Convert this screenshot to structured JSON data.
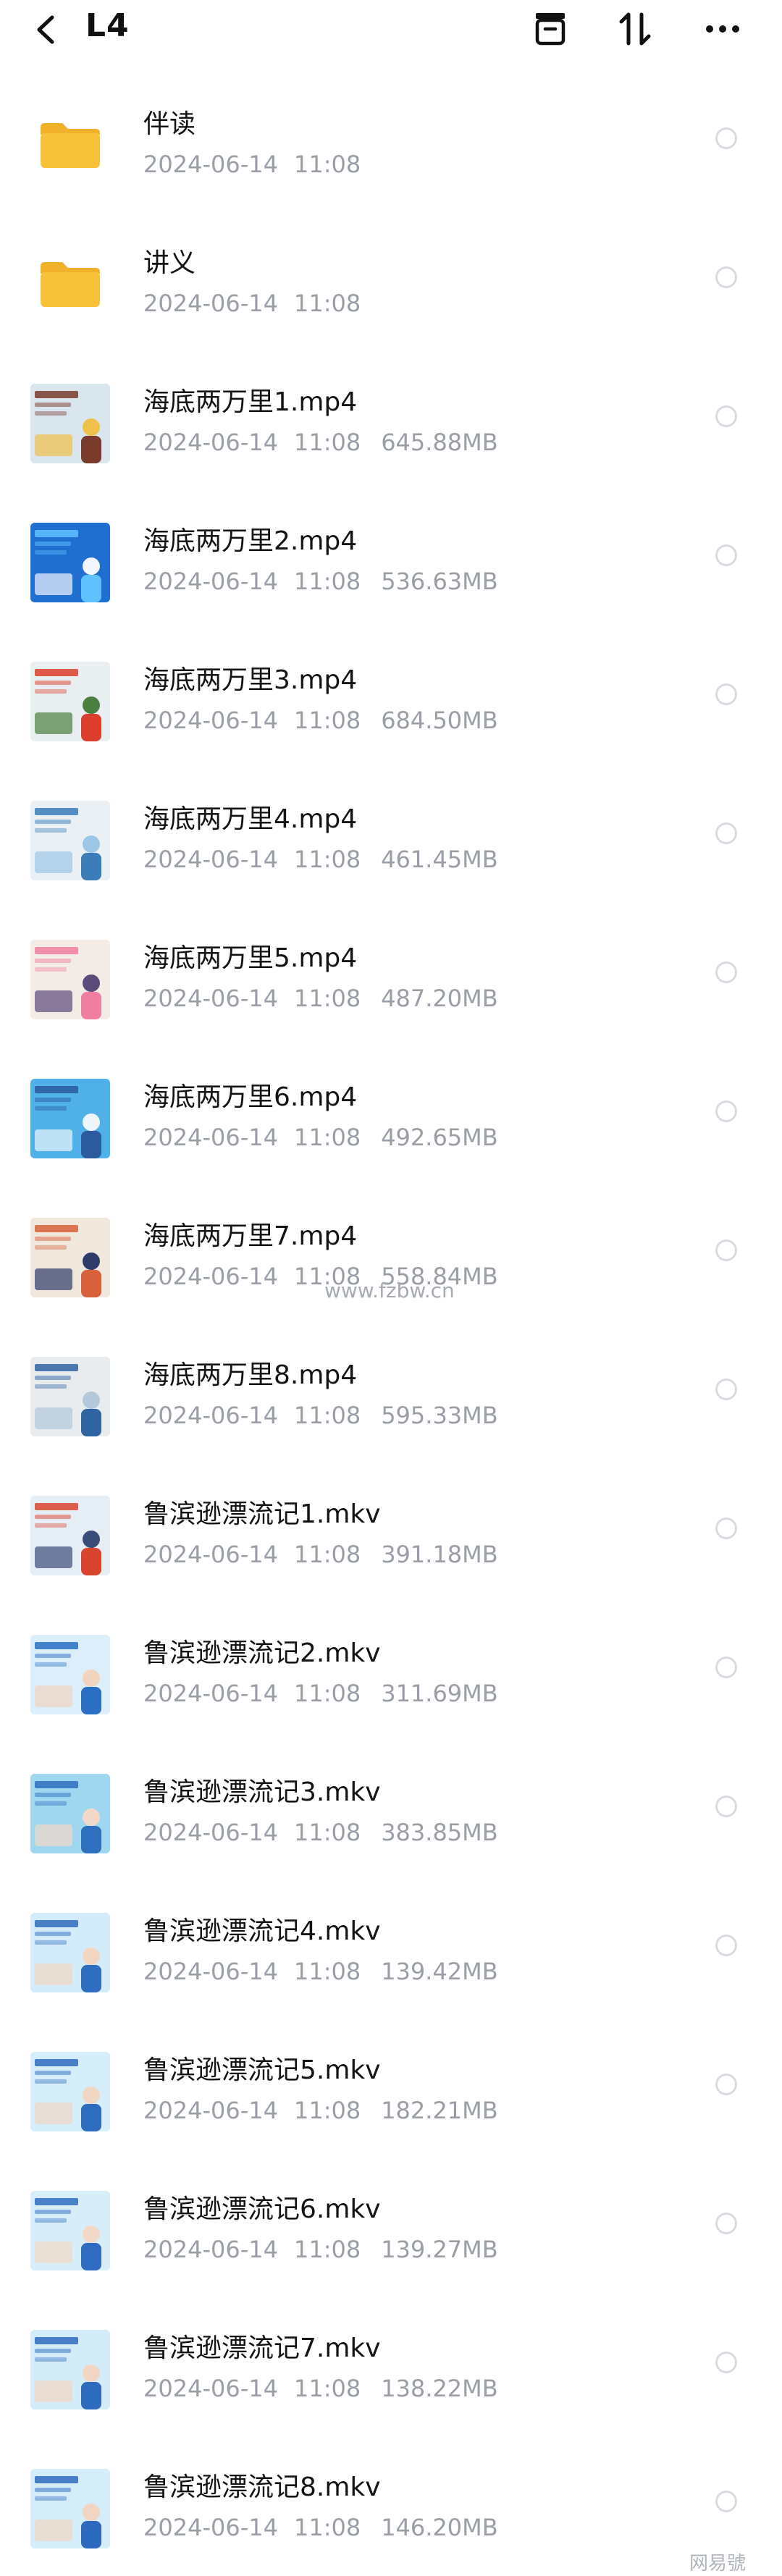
{
  "header": {
    "title": "L4"
  },
  "files": [
    {
      "name": "伴读",
      "date": "2024-06-14",
      "time": "11:08",
      "size": "",
      "type": "folder"
    },
    {
      "name": "讲义",
      "date": "2024-06-14",
      "time": "11:08",
      "size": "",
      "type": "folder"
    },
    {
      "name": "海底两万里1.mp4",
      "date": "2024-06-14",
      "time": "11:08",
      "size": "645.88MB",
      "type": "video",
      "thumb_colors": [
        "#d9e6ee",
        "#7a3a2c",
        "#f0c14a"
      ]
    },
    {
      "name": "海底两万里2.mp4",
      "date": "2024-06-14",
      "time": "11:08",
      "size": "536.63MB",
      "type": "video",
      "thumb_colors": [
        "#1f6fd0",
        "#5fc2ff",
        "#f3f7ff"
      ]
    },
    {
      "name": "海底两万里3.mp4",
      "date": "2024-06-14",
      "time": "11:08",
      "size": "684.50MB",
      "type": "video",
      "thumb_colors": [
        "#e9eef1",
        "#db3f2c",
        "#4b7f3f"
      ]
    },
    {
      "name": "海底两万里4.mp4",
      "date": "2024-06-14",
      "time": "11:08",
      "size": "461.45MB",
      "type": "video",
      "thumb_colors": [
        "#eaf0f4",
        "#3a7db8",
        "#9cc6e6"
      ]
    },
    {
      "name": "海底两万里5.mp4",
      "date": "2024-06-14",
      "time": "11:08",
      "size": "487.20MB",
      "type": "video",
      "thumb_colors": [
        "#f3ece6",
        "#f07ea0",
        "#5b4a7a"
      ]
    },
    {
      "name": "海底两万里6.mp4",
      "date": "2024-06-14",
      "time": "11:08",
      "size": "492.65MB",
      "type": "video",
      "thumb_colors": [
        "#4fb1e8",
        "#2b5b9c",
        "#eef6fb"
      ]
    },
    {
      "name": "海底两万里7.mp4",
      "date": "2024-06-14",
      "time": "11:08",
      "size": "558.84MB",
      "type": "video",
      "thumb_colors": [
        "#f0e8dc",
        "#d8603a",
        "#2f3b6b"
      ]
    },
    {
      "name": "海底两万里8.mp4",
      "date": "2024-06-14",
      "time": "11:08",
      "size": "595.33MB",
      "type": "video",
      "thumb_colors": [
        "#e8ecef",
        "#2f64a3",
        "#b4c8dc"
      ]
    },
    {
      "name": "鲁滨逊漂流记1.mkv",
      "date": "2024-06-14",
      "time": "11:08",
      "size": "391.18MB",
      "type": "video",
      "thumb_colors": [
        "#e6eef5",
        "#d9442f",
        "#3a4c78"
      ]
    },
    {
      "name": "鲁滨逊漂流记2.mkv",
      "date": "2024-06-14",
      "time": "11:08",
      "size": "311.69MB",
      "type": "video",
      "thumb_colors": [
        "#dbeefa",
        "#2a6fc4",
        "#f1d4c0"
      ]
    },
    {
      "name": "鲁滨逊漂流记3.mkv",
      "date": "2024-06-14",
      "time": "11:08",
      "size": "383.85MB",
      "type": "video",
      "thumb_colors": [
        "#9fd6f0",
        "#2e6fbe",
        "#f3d8c8"
      ]
    },
    {
      "name": "鲁滨逊漂流记4.mkv",
      "date": "2024-06-14",
      "time": "11:08",
      "size": "139.42MB",
      "type": "video",
      "thumb_colors": [
        "#d4ecf9",
        "#2f6dc0",
        "#f1d7c2"
      ]
    },
    {
      "name": "鲁滨逊漂流记5.mkv",
      "date": "2024-06-14",
      "time": "11:08",
      "size": "182.21MB",
      "type": "video",
      "thumb_colors": [
        "#d6eef9",
        "#2e6cbf",
        "#f0d6c4"
      ]
    },
    {
      "name": "鲁滨逊漂流记6.mkv",
      "date": "2024-06-14",
      "time": "11:08",
      "size": "139.27MB",
      "type": "video",
      "thumb_colors": [
        "#d7eef9",
        "#2f6cc1",
        "#f2d8c6"
      ]
    },
    {
      "name": "鲁滨逊漂流记7.mkv",
      "date": "2024-06-14",
      "time": "11:08",
      "size": "138.22MB",
      "type": "video",
      "thumb_colors": [
        "#d3ecf8",
        "#2e6bbf",
        "#f1d6c3"
      ]
    },
    {
      "name": "鲁滨逊漂流记8.mkv",
      "date": "2024-06-14",
      "time": "11:08",
      "size": "146.20MB",
      "type": "video",
      "thumb_colors": [
        "#d5edf9",
        "#2d6abf",
        "#f0d5c2"
      ]
    }
  ],
  "watermark": "www.fzbw.cn",
  "corner_mark": "网易號",
  "colors": {
    "folder": "#f7c23a",
    "folder_tab": "#f2b12a",
    "meta": "#9a9ea6",
    "radio": "#d9dbe0"
  },
  "icons": {
    "back": "chevron-left-icon",
    "archive": "archive-box-icon",
    "sort": "sort-arrows-icon",
    "more": "more-dots-icon"
  }
}
